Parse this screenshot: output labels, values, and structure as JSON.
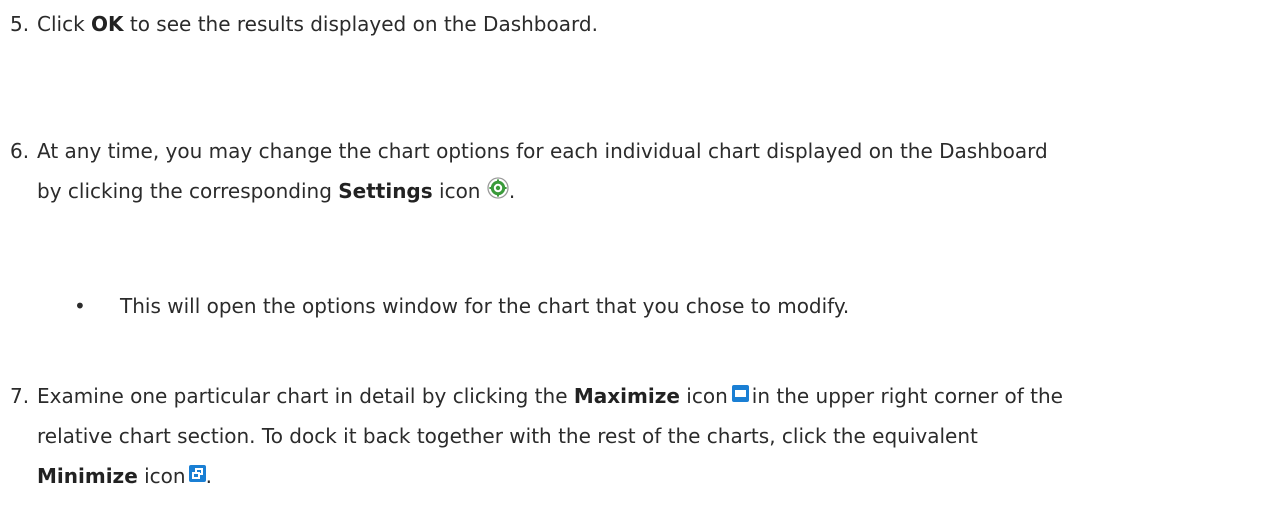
{
  "steps": [
    {
      "number": "5.",
      "before": "Click ",
      "bold": "OK",
      "after": " to see the results displayed on the Dashboard."
    },
    {
      "number": "6.",
      "line1": "At any time, you may change the chart options for each individual chart displayed on the Dashboard",
      "before": "by clicking the corresponding ",
      "bold": "Settings",
      "after": " icon",
      "end": ".",
      "icon": "settings-gear-icon"
    },
    {
      "number": "7.",
      "before": "Examine one particular chart in detail by clicking the ",
      "bold": "Maximize",
      "after": " icon",
      "after_icon": "in the upper right corner of the",
      "line2": "relative chart section. To dock it back together with the rest of the charts, click the equivalent",
      "bold2": "Minimize",
      "after2": " icon",
      "end": ".",
      "icon1": "maximize-icon",
      "icon2": "minimize-icon"
    }
  ],
  "bullets": [
    {
      "symbol": "•",
      "text": "This will open the options window for the chart that you chose to modify."
    }
  ],
  "colors": {
    "text": "#2b2b2b",
    "icon_blue": "#1a7fd4",
    "gear_green": "#3a9a3a"
  }
}
